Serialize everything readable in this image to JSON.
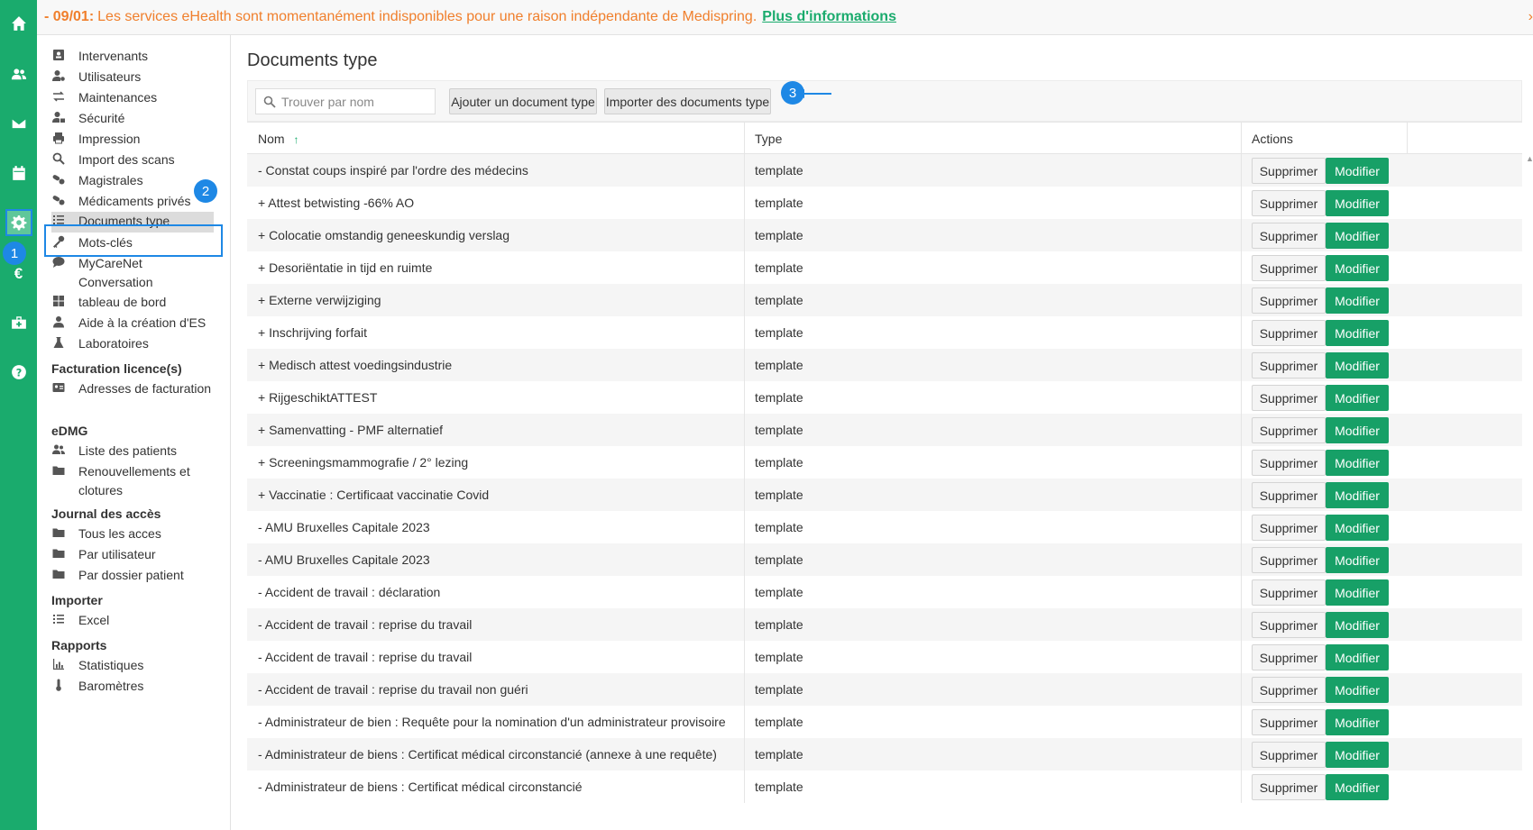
{
  "banner": {
    "date": "- 09/01:",
    "message": "Les services eHealth sont momentanément indisponibles pour une raison indépendante de Medispring.",
    "link": "Plus d'informations"
  },
  "rail": {
    "icons": [
      "home-icon",
      "users-icon",
      "mail-icon",
      "calendar-icon",
      "gear-icon",
      "euro-icon",
      "medkit-icon",
      "help-icon"
    ],
    "step1": "1"
  },
  "sidebar": {
    "items": [
      {
        "label": "Intervenants",
        "icon": "id-card-icon"
      },
      {
        "label": "Utilisateurs",
        "icon": "user-gear-icon"
      },
      {
        "label": "Maintenances",
        "icon": "swap-icon"
      },
      {
        "label": "Sécurité",
        "icon": "user-lock-icon"
      },
      {
        "label": "Impression",
        "icon": "printer-icon"
      },
      {
        "label": "Import des scans",
        "icon": "search-icon"
      },
      {
        "label": "Magistrales",
        "icon": "pills-icon"
      },
      {
        "label": "Médicaments privés",
        "icon": "pills-icon"
      },
      {
        "label": "Documents type",
        "icon": "list-icon"
      },
      {
        "label": "Mots-clés",
        "icon": "key-icon"
      },
      {
        "label": "MyCareNet Conversation",
        "icon": "chat-icon"
      },
      {
        "label": "tableau de bord",
        "icon": "grid-icon"
      },
      {
        "label": "Aide à la création d'ES",
        "icon": "user-icon"
      },
      {
        "label": "Laboratoires",
        "icon": "flask-icon"
      }
    ],
    "step2": "2",
    "sections": {
      "facturation": {
        "title": "Facturation licence(s)",
        "items": [
          "Adresses de facturation"
        ]
      },
      "edmg": {
        "title": "eDMG",
        "items": [
          "Liste des patients",
          "Renouvellements et clotures"
        ]
      },
      "journal": {
        "title": "Journal des accès",
        "items": [
          "Tous les acces",
          "Par utilisateur",
          "Par dossier patient"
        ]
      },
      "importer": {
        "title": "Importer",
        "items": [
          "Excel"
        ]
      },
      "rapports": {
        "title": "Rapports",
        "items": [
          "Statistiques",
          "Baromètres"
        ]
      }
    }
  },
  "main": {
    "title": "Documents type",
    "search_placeholder": "Trouver par nom",
    "add_button": "Ajouter un document type",
    "import_button": "Importer des documents type",
    "step3": "3",
    "columns": {
      "name": "Nom",
      "sort": "↑",
      "type": "Type",
      "actions": "Actions"
    },
    "delete_label": "Supprimer",
    "edit_label": "Modifier",
    "rows": [
      {
        "name": "- Constat coups inspiré par l'ordre des médecins",
        "type": "template"
      },
      {
        "name": "+ Attest betwisting -66% AO",
        "type": "template"
      },
      {
        "name": "+ Colocatie omstandig geneeskundig verslag",
        "type": "template"
      },
      {
        "name": "+ Desoriëntatie in tijd en ruimte",
        "type": "template"
      },
      {
        "name": "+ Externe verwijziging",
        "type": "template"
      },
      {
        "name": "+ Inschrijving forfait",
        "type": "template"
      },
      {
        "name": "+ Medisch attest voedingsindustrie",
        "type": "template"
      },
      {
        "name": "+ RijgeschiktATTEST",
        "type": "template"
      },
      {
        "name": "+ Samenvatting - PMF alternatief",
        "type": "template"
      },
      {
        "name": "+ Screeningsmammografie / 2° lezing",
        "type": "template"
      },
      {
        "name": "+ Vaccinatie : Certificaat vaccinatie Covid",
        "type": "template"
      },
      {
        "name": "- AMU Bruxelles Capitale 2023",
        "type": "template"
      },
      {
        "name": "- AMU Bruxelles Capitale 2023",
        "type": "template"
      },
      {
        "name": "- Accident de travail : déclaration",
        "type": "template"
      },
      {
        "name": "- Accident de travail : reprise du travail",
        "type": "template"
      },
      {
        "name": "- Accident de travail : reprise du travail",
        "type": "template"
      },
      {
        "name": "- Accident de travail : reprise du travail non guéri",
        "type": "template"
      },
      {
        "name": "- Administrateur de bien : Requête pour la nomination d'un administrateur provisoire",
        "type": "template"
      },
      {
        "name": "- Administrateur de biens : Certificat médical circonstancié (annexe à une requête)",
        "type": "template"
      },
      {
        "name": "- Administrateur de biens : Certificat médical circonstancié",
        "type": "template"
      }
    ]
  },
  "colors": {
    "brand": "#1aab6d",
    "warning": "#f07f2c",
    "annotation": "#1e88e5"
  }
}
